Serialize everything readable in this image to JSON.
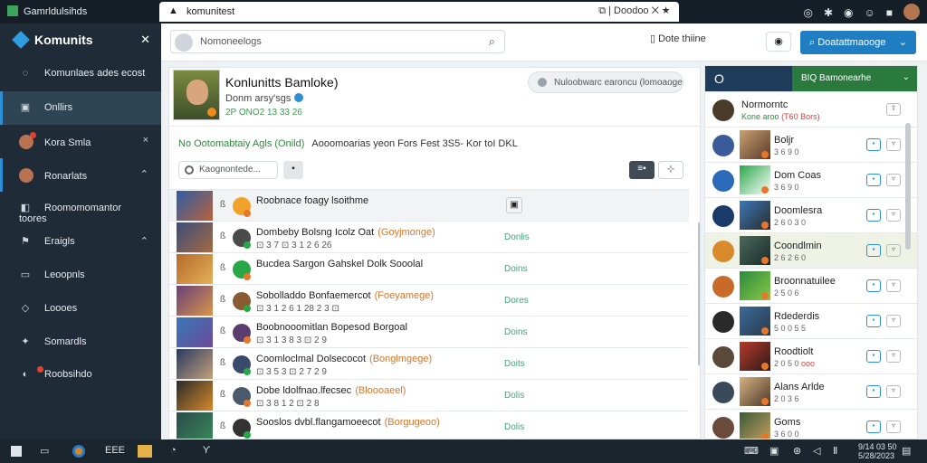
{
  "window": {
    "app_title": "Gamrldulsihds",
    "tab_title": "komunitest",
    "tab_right": "Doodoo",
    "sys_icons": [
      "bell-icon",
      "puzzle-icon",
      "shield-icon",
      "smile-icon",
      "pin-icon"
    ]
  },
  "sidebar": {
    "brand": "Komunits",
    "items": [
      {
        "label": "Komunlaes ades ecost",
        "icon": "chat-icon",
        "right": ""
      },
      {
        "label": "Onllirs",
        "icon": "monitor-icon",
        "right": ""
      },
      {
        "label": "Kora Smla",
        "icon": "avatar",
        "right": "×"
      },
      {
        "label": "Ronarlats",
        "icon": "avatar",
        "right": "⌃"
      },
      {
        "label": "Roomomomantor toores",
        "icon": "gamepad-icon",
        "right": ""
      },
      {
        "label": "Eraigls",
        "icon": "flag-icon",
        "right": "⌃"
      },
      {
        "label": "Leoopnls",
        "icon": "folder-icon",
        "right": ""
      },
      {
        "label": "Loooes",
        "icon": "tag-icon",
        "right": ""
      },
      {
        "label": "Somardls",
        "icon": "puzzle-icon",
        "right": ""
      },
      {
        "label": "Roobsihdo",
        "icon": "settings-icon",
        "right": ""
      }
    ]
  },
  "topbar": {
    "search_placeholder": "Nomoneelogs",
    "btn_store": "Dote thiine",
    "primary": "Doatattmaooge"
  },
  "profile": {
    "name": "Konlunitts Bamloke)",
    "sub": "Donm arsy'sgs",
    "stat": "2P ONO2 13 33 26",
    "announcement": "Nuloobwarc earoncu (lomoaoge..."
  },
  "notice": {
    "green": "No Ootomabtaiy Agls (Onild)",
    "rest": "Aooomoarias yeon Fors Fest 3S5- Kor toI DKL"
  },
  "filter": {
    "placeholder": "Kaognontede...",
    "btn": "▪",
    "view1": "≡▪",
    "view2": "⊹"
  },
  "rows": [
    {
      "title": "Roobnace foagy lsoithme",
      "tag": "",
      "meta": "",
      "status": "",
      "lead": "ß",
      "icon_color": "#f0a22a",
      "thumb": [
        "#2c5ea8",
        "#b9623a"
      ]
    },
    {
      "title": "Dombeby Bolsng Icolz Oat",
      "tag": "(Goyjmonge)",
      "meta": "⊡ 3 7 ⊡ 3 1 2 6 26",
      "status": "Donlis",
      "lead": "ß",
      "icon_color": "#4a4a4a",
      "thumb": [
        "#3b4d78",
        "#a36a44"
      ]
    },
    {
      "title": "Bucdea Sargon Gahskel Dolk Sooolal",
      "tag": "",
      "meta": "",
      "status": "Doins",
      "lead": "ß",
      "icon_color": "#27a745",
      "thumb": [
        "#b56a2a",
        "#e3b15a"
      ]
    },
    {
      "title": "Sobolladdo Bonfaemercot",
      "tag": "(Foeyamege)",
      "meta": "⊡ 3 1 2 6 1 28 2 3 ⊡",
      "status": "Dores",
      "lead": "ß",
      "icon_color": "#8a5a32",
      "thumb": [
        "#6a3f78",
        "#d8964a"
      ]
    },
    {
      "title": "Boobnooomitlan Bopesod Borgoal",
      "tag": "",
      "meta": "⊡ 3 1 3 8 3 ⊡ 2 9",
      "status": "Doins",
      "lead": "ß",
      "icon_color": "#5a3c6e",
      "thumb": [
        "#3a78b8",
        "#6a4a9a"
      ]
    },
    {
      "title": "Coomloclmal Dolsecocot",
      "tag": "(Bonglmgege)",
      "meta": "⊡ 3 5 3 ⊡ 2 7 2 9",
      "status": "Doits",
      "lead": "ß",
      "icon_color": "#3a4a6a",
      "thumb": [
        "#2a3a60",
        "#c2a07a"
      ]
    },
    {
      "title": "Dobe ldolfnao.lfecsec",
      "tag": "(Bloooaeel)",
      "meta": "⊡ 3 8 1 2 ⊡ 2 8",
      "status": "Dolis",
      "lead": "ß",
      "icon_color": "#4a5a6a",
      "thumb": [
        "#2a2a2a",
        "#d68a2a"
      ]
    },
    {
      "title": "Sooslos dvbl.flangamoeecot",
      "tag": "(Borgugeoo)",
      "meta": "",
      "status": "Dolis",
      "lead": "ß",
      "icon_color": "#333333",
      "thumb": [
        "#2a4a4a",
        "#3a8a5a"
      ]
    }
  ],
  "right_panel": {
    "head_o": "O",
    "green": "BIQ Bamonearhe",
    "items": [
      {
        "name": "Normorntc",
        "sub": "Kone aroo",
        "sub2": "(T60 Bors)",
        "ava": "#4a3a2a",
        "img": [
          "#ffffff",
          "#ffffff"
        ],
        "hl": false
      },
      {
        "name": "Boljr",
        "sub": "3 6 9 0",
        "sub2": "",
        "ava": "#3a5a9a",
        "img": [
          "#c8a070",
          "#5a3a2a"
        ],
        "hl": false
      },
      {
        "name": "Dom Coas",
        "sub": "3 6 9 0",
        "sub2": "",
        "ava": "#2a6ab8",
        "img": [
          "#2aa84a",
          "#ffffff"
        ],
        "hl": false
      },
      {
        "name": "Doomlesra",
        "sub": "2 6 0 3 0",
        "sub2": "",
        "ava": "#1a3a6a",
        "img": [
          "#3a78b8",
          "#2a2a2a"
        ],
        "hl": false
      },
      {
        "name": "Coondlmin",
        "sub": "2 6 2 6 0",
        "sub2": "",
        "ava": "#d88a2a",
        "img": [
          "#4a6a5a",
          "#1a2a2a"
        ],
        "hl": true
      },
      {
        "name": "Broonnatuilee",
        "sub": "2 5 0 6",
        "sub2": "",
        "ava": "#c86a2a",
        "img": [
          "#2a8a3a",
          "#8ac84a"
        ],
        "hl": false
      },
      {
        "name": "Rdederdis",
        "sub": "5 0 0 5 5",
        "sub2": "",
        "ava": "#2a2a2a",
        "img": [
          "#3a6a9a",
          "#2a3a4a"
        ],
        "hl": false
      },
      {
        "name": "Roodtiolt",
        "sub": "2 0 5 0",
        "sub2": "ooo",
        "ava": "#5a4a3a",
        "img": [
          "#b83a2a",
          "#2a1a1a"
        ],
        "hl": false
      },
      {
        "name": "Alans Arlde",
        "sub": "2 0 3 6",
        "sub2": "",
        "ava": "#3a4a5a",
        "img": [
          "#d8b080",
          "#4a3a2a"
        ],
        "hl": false
      },
      {
        "name": "Goms",
        "sub": "3 6 0 0",
        "sub2": "",
        "ava": "#6a4a3a",
        "img": [
          "#3a5a3a",
          "#c8a060"
        ],
        "hl": false
      }
    ]
  },
  "taskbar": {
    "items": [
      "EEE",
      "Ƴ"
    ],
    "clock_time": "9/14 03 50",
    "clock_date": "5/28/2023"
  }
}
